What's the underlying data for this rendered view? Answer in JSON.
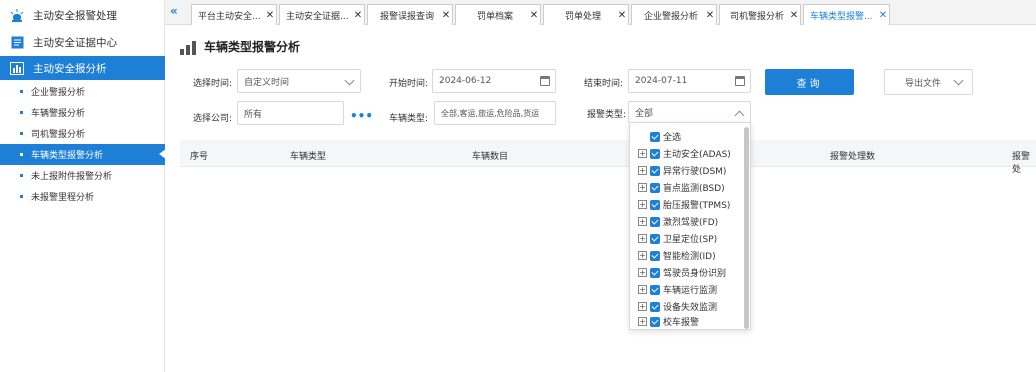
{
  "sidebar": {
    "main": [
      {
        "label": "主动安全报警处理",
        "icon": "alarm-light-icon"
      },
      {
        "label": "主动安全证据中心",
        "icon": "document-icon"
      },
      {
        "label": "主动安全报分析",
        "icon": "chart-icon"
      }
    ],
    "sub": [
      {
        "label": "企业警报分析"
      },
      {
        "label": "车辆警报分析"
      },
      {
        "label": "司机警报分析"
      },
      {
        "label": "车辆类型报警分析"
      },
      {
        "label": "未上报附件报警分析"
      },
      {
        "label": "未报警里程分析"
      }
    ]
  },
  "tabs": [
    {
      "label": "平台主动安全..."
    },
    {
      "label": "主动安全证据..."
    },
    {
      "label": "报警误报查询"
    },
    {
      "label": "罚单档案"
    },
    {
      "label": "罚单处理"
    },
    {
      "label": "企业警报分析"
    },
    {
      "label": "司机警报分析"
    },
    {
      "label": "车辆类型报警..."
    }
  ],
  "page_title": "车辆类型报警分析",
  "form": {
    "select_time_label": "选择时间:",
    "select_time_value": "自定义时间",
    "start_time_label": "开始时间:",
    "start_time_value": "2024-06-12",
    "end_time_label": "结束时间:",
    "end_time_value": "2024-07-11",
    "query_label": "查询",
    "export_label": "导出文件",
    "company_label": "选择公司:",
    "company_value": "所有",
    "vehicle_type_label": "车辆类型:",
    "vehicle_type_value": "全部,客运,旅运,危险品,货运",
    "alarm_type_label": "报警类型:",
    "alarm_type_value": "全部"
  },
  "table": {
    "headers": [
      "序号",
      "车辆类型",
      "车辆数目",
      "报警处理数",
      "报警处"
    ]
  },
  "dropdown": {
    "items": [
      {
        "label": "全选",
        "expandable": false
      },
      {
        "label": "主动安全(ADAS)",
        "expandable": true
      },
      {
        "label": "异常行驶(DSM)",
        "expandable": true
      },
      {
        "label": "盲点监测(BSD)",
        "expandable": true
      },
      {
        "label": "胎压报警(TPMS)",
        "expandable": true
      },
      {
        "label": "激烈驾驶(FD)",
        "expandable": true
      },
      {
        "label": "卫星定位(SP)",
        "expandable": true
      },
      {
        "label": "智能检测(ID)",
        "expandable": true
      },
      {
        "label": "驾驶员身份识别",
        "expandable": true
      },
      {
        "label": "车辆运行监测",
        "expandable": true
      },
      {
        "label": "设备失效监测",
        "expandable": true
      },
      {
        "label": "校车报警",
        "expandable": true
      }
    ]
  },
  "colors": {
    "accent": "#1e7fd6"
  }
}
